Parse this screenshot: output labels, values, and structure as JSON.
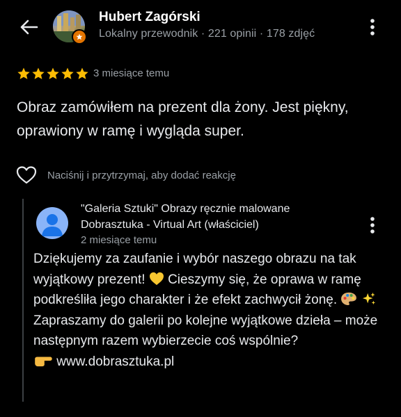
{
  "reviewer": {
    "name": "Hubert Zagórski",
    "meta": "Lokalny przewodnik · 221 opinii · 178 zdjęć"
  },
  "review": {
    "rating": 5,
    "date": "3 miesiące temu",
    "text": "Obraz zamówiłem na prezent dla żony. Jest piękny, oprawiony w ramę i wygląda super.",
    "reaction_hint": "Naciśnij i przytrzymaj, aby dodać reakcję"
  },
  "owner_reply": {
    "owner_name": "\"Galeria Sztuki\" Obrazy ręcznie malowane Dobrasztuka - Virtual Art (właściciel)",
    "date": "2 miesiące temu",
    "text_1": "Dziękujemy za zaufanie i wybór naszego obrazu na tak wyjątkowy prezent!",
    "text_2": "Cieszymy się, że oprawa w ramę podkreśliła jego charakter i że efekt zachwycił żonę.",
    "text_3": "Zapraszamy do galerii po kolejne wyjątkowe dzieła – może następnym razem wybierzecie coś wspólnie?",
    "link": "www.dobrasztuka.pl"
  },
  "icons": {
    "back": "arrow-left-icon",
    "more": "more-vert-icon",
    "star": "star-icon",
    "like": "heart-outline-icon",
    "emoji_heart": "yellow-heart-emoji",
    "emoji_palette": "artist-palette-emoji",
    "emoji_sparkles": "sparkles-emoji",
    "emoji_point": "pointing-right-emoji"
  },
  "colors": {
    "background": "#000000",
    "star": "#fbbc04",
    "secondary_text": "#9aa0a6",
    "guide_badge": "#e37400",
    "owner_avatar": "#8ab4f8"
  }
}
